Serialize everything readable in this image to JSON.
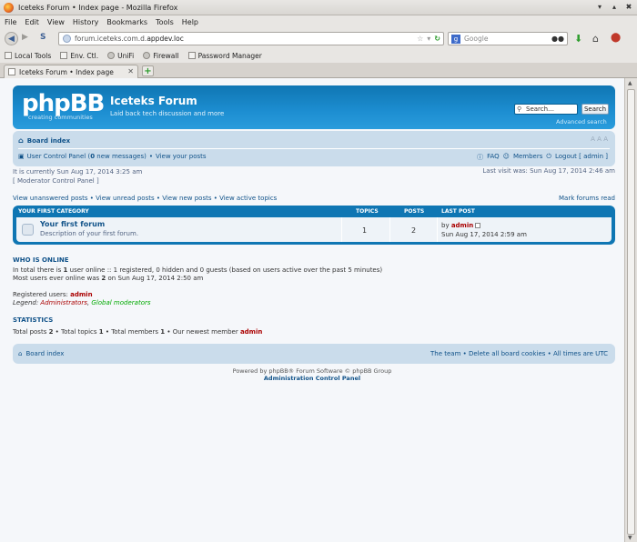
{
  "window": {
    "title": "Iceteks Forum • Index page - Mozilla Firefox"
  },
  "menu": [
    "File",
    "Edit",
    "View",
    "History",
    "Bookmarks",
    "Tools",
    "Help"
  ],
  "url": {
    "prefix": "forum.iceteks.com.d.",
    "host": "appdev.loc"
  },
  "search_engine": {
    "placeholder": "Google"
  },
  "bookmarks": [
    "Local Tools",
    "Env. Ctl.",
    "UniFi",
    "Firewall",
    "Password Manager"
  ],
  "tab": {
    "label": "Iceteks Forum • Index page"
  },
  "header": {
    "logo_word": "phpBB",
    "logo_tag": "creating communities",
    "site_title": "Iceteks Forum",
    "site_desc": "Laid back tech discussion and more",
    "search_value": "Search…",
    "search_button": "Search",
    "advanced_search": "Advanced search"
  },
  "nav": {
    "board_index": "Board index",
    "font_size": "A A A",
    "ucp": "User Control Panel",
    "ucp_count_open": " (",
    "ucp_count": "0",
    "ucp_count_close": " new messages)",
    "bullet": "•",
    "view_posts": "View your posts",
    "faq": "FAQ",
    "members": "Members",
    "logout": "Logout [ admin ]"
  },
  "times": {
    "current": "It is currently Sun Aug 17, 2014 3:25 am",
    "mcp": "[ Moderator Control Panel ]",
    "last_visit": "Last visit was: Sun Aug 17, 2014 2:46 am"
  },
  "quicklinks": {
    "text": "View unanswered posts • View unread posts • View new posts • View active topics",
    "mark_read": "Mark forums read"
  },
  "category": {
    "title": "YOUR FIRST CATEGORY",
    "col_topics": "TOPICS",
    "col_posts": "POSTS",
    "col_last": "LAST POST",
    "forum": {
      "name": "Your first forum",
      "description": "Description of your first forum.",
      "topics": "1",
      "posts": "2",
      "last_by": "by ",
      "last_author": "admin",
      "last_time": "Sun Aug 17, 2014 2:59 am"
    }
  },
  "online": {
    "title": "WHO IS ONLINE",
    "line1_a": "In total there is ",
    "line1_b": "1",
    "line1_c": " user online :: 1 registered, 0 hidden and 0 guests (based on users active over the past 5 minutes)",
    "line2_a": "Most users ever online was ",
    "line2_b": "2",
    "line2_c": " on Sun Aug 17, 2014 2:50 am",
    "registered_label": "Registered users: ",
    "registered_user": "admin",
    "legend_label": "Legend: ",
    "legend_admins": "Administrators",
    "legend_sep": ", ",
    "legend_mods": "Global moderators"
  },
  "stats": {
    "title": "STATISTICS",
    "a": "Total posts ",
    "b": "2",
    "c": " • Total topics ",
    "d": "1",
    "e": " • Total members ",
    "f": "1",
    "g": " • Our newest member ",
    "h": "admin"
  },
  "footer": {
    "board_index": "Board index",
    "right": "The team • Delete all board cookies • All times are UTC",
    "powered": "Powered by phpBB® Forum Software © phpBB Group",
    "acp": "Administration Control Panel"
  }
}
